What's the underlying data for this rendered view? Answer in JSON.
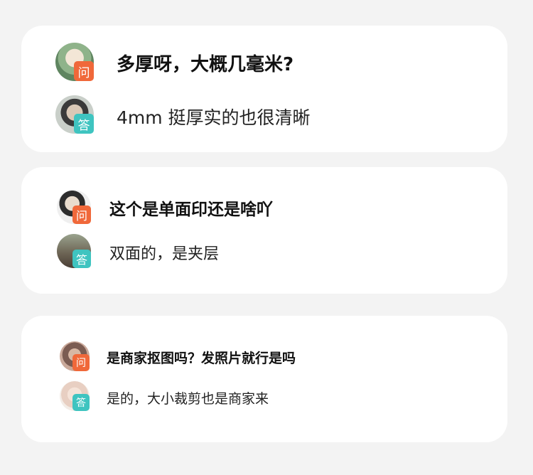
{
  "cards": [
    {
      "question": {
        "badge": "问",
        "text": "多厚呀，大概几毫米?"
      },
      "answer": {
        "badge": "答",
        "text": "4mm 挺厚实的也很清晰"
      }
    },
    {
      "question": {
        "badge": "问",
        "text": "这个是单面印还是啥吖"
      },
      "answer": {
        "badge": "答",
        "text": "双面的，是夹层"
      }
    },
    {
      "question": {
        "badge": "问",
        "text": "是商家抠图吗？发照片就行是吗"
      },
      "answer": {
        "badge": "答",
        "text": "是的，大小裁剪也是商家来"
      }
    }
  ],
  "colors": {
    "question_badge": "#f0683a",
    "answer_badge": "#3fc4c0",
    "card_bg": "#ffffff",
    "page_bg": "#f3f3f3"
  }
}
